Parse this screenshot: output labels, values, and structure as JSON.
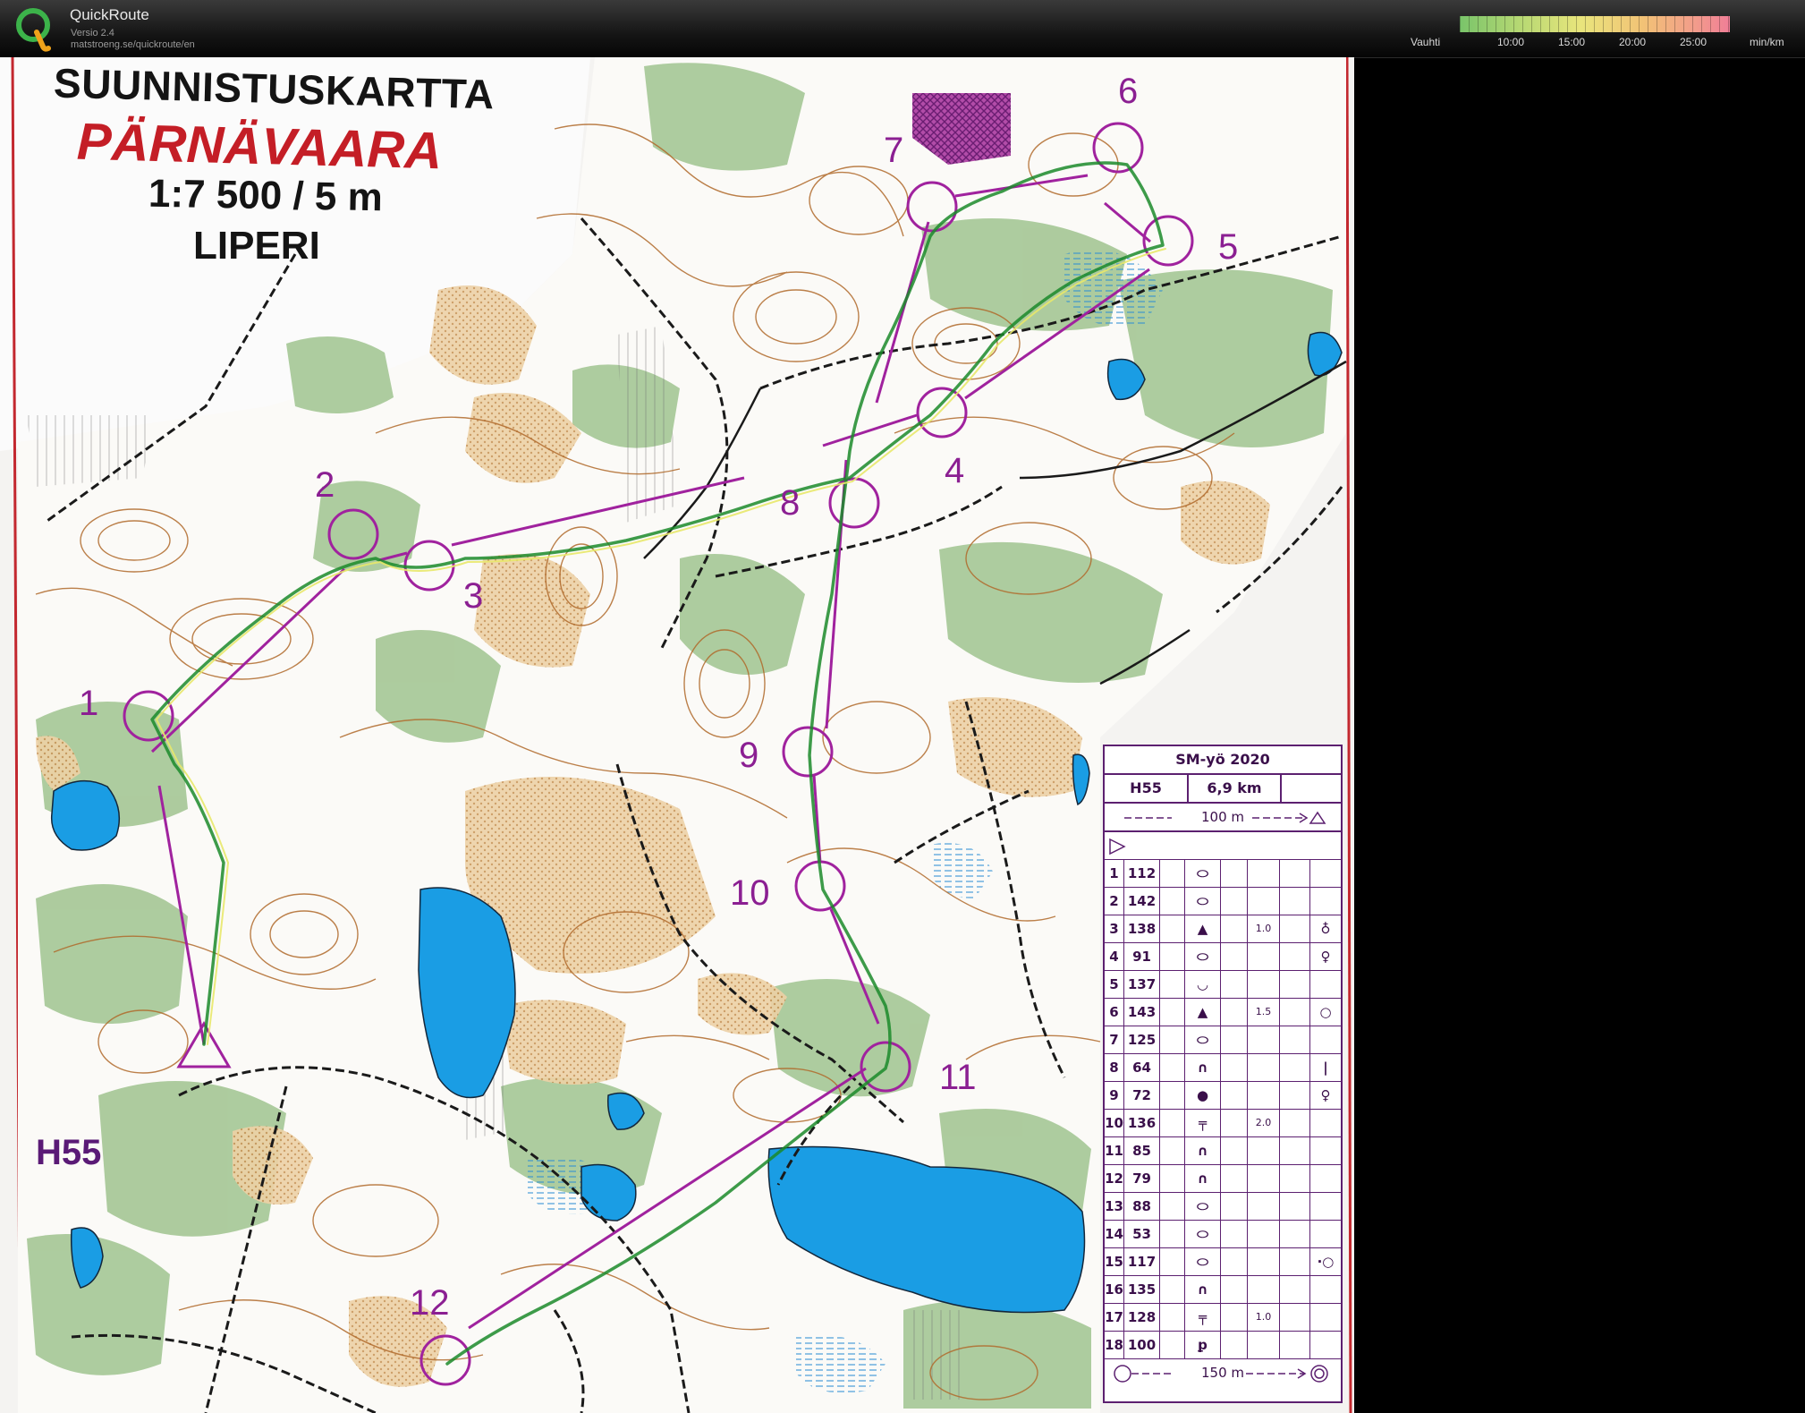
{
  "app": {
    "name": "QuickRoute",
    "version": "Versio 2.4",
    "url": "matstroeng.se/quickroute/en"
  },
  "pace_legend": {
    "label": "Vauhti",
    "unit": "min/km",
    "ticks": [
      "10:00",
      "15:00",
      "20:00",
      "25:00"
    ]
  },
  "map": {
    "title": "SUUNNISTUSKARTTA",
    "name": "PÄRNÄVAARA",
    "scale": "1:7 500 / 5 m",
    "place": "LIPERI",
    "class_label": "H55",
    "colors": {
      "paper": "#f7f6f4",
      "open_yellow": "#ecd0a4",
      "green": "#a9c99a",
      "water": "#1a9de4",
      "contour": "#b06a2b",
      "course": "#a0229e"
    },
    "controls": [
      {
        "number": "1"
      },
      {
        "number": "2"
      },
      {
        "number": "3"
      },
      {
        "number": "4"
      },
      {
        "number": "5"
      },
      {
        "number": "6"
      },
      {
        "number": "7"
      },
      {
        "number": "8"
      },
      {
        "number": "9"
      },
      {
        "number": "10"
      },
      {
        "number": "11"
      },
      {
        "number": "12"
      }
    ]
  },
  "description_sheet": {
    "event": "SM-yö 2020",
    "class": "H55",
    "length": "6,9 km",
    "start_distance": "100 m",
    "finish_distance": "150 m",
    "rows": [
      {
        "no": "1",
        "code": "112",
        "dim": "",
        "symbol": "⬭",
        "extra": ""
      },
      {
        "no": "2",
        "code": "142",
        "dim": "",
        "symbol": "⬭",
        "extra": ""
      },
      {
        "no": "3",
        "code": "138",
        "dim": "1.0",
        "symbol": "▲",
        "extra": "♁"
      },
      {
        "no": "4",
        "code": "91",
        "dim": "",
        "symbol": "⬭",
        "extra": "♀"
      },
      {
        "no": "5",
        "code": "137",
        "dim": "",
        "symbol": "◡",
        "extra": ""
      },
      {
        "no": "6",
        "code": "143",
        "dim": "1.5",
        "symbol": "▲",
        "extra": "○"
      },
      {
        "no": "7",
        "code": "125",
        "dim": "",
        "symbol": "⬭",
        "extra": ""
      },
      {
        "no": "8",
        "code": "64",
        "dim": "",
        "symbol": "∩",
        "extra": "|"
      },
      {
        "no": "9",
        "code": "72",
        "dim": "",
        "symbol": "●",
        "extra": "♀"
      },
      {
        "no": "10",
        "code": "136",
        "dim": "2.0",
        "symbol": "╤",
        "extra": ""
      },
      {
        "no": "11",
        "code": "85",
        "dim": "",
        "symbol": "∩",
        "extra": ""
      },
      {
        "no": "12",
        "code": "79",
        "dim": "",
        "symbol": "∩",
        "extra": ""
      },
      {
        "no": "13",
        "code": "88",
        "dim": "",
        "symbol": "⬭",
        "extra": ""
      },
      {
        "no": "14",
        "code": "53",
        "dim": "",
        "symbol": "⬭",
        "extra": ""
      },
      {
        "no": "15",
        "code": "117",
        "dim": "",
        "symbol": "⬭",
        "extra": "·○"
      },
      {
        "no": "16",
        "code": "135",
        "dim": "",
        "symbol": "∩",
        "extra": ""
      },
      {
        "no": "17",
        "code": "128",
        "dim": "1.0",
        "symbol": "╤",
        "extra": ""
      },
      {
        "no": "18",
        "code": "100",
        "dim": "",
        "symbol": "ꝑ",
        "extra": ""
      }
    ]
  }
}
